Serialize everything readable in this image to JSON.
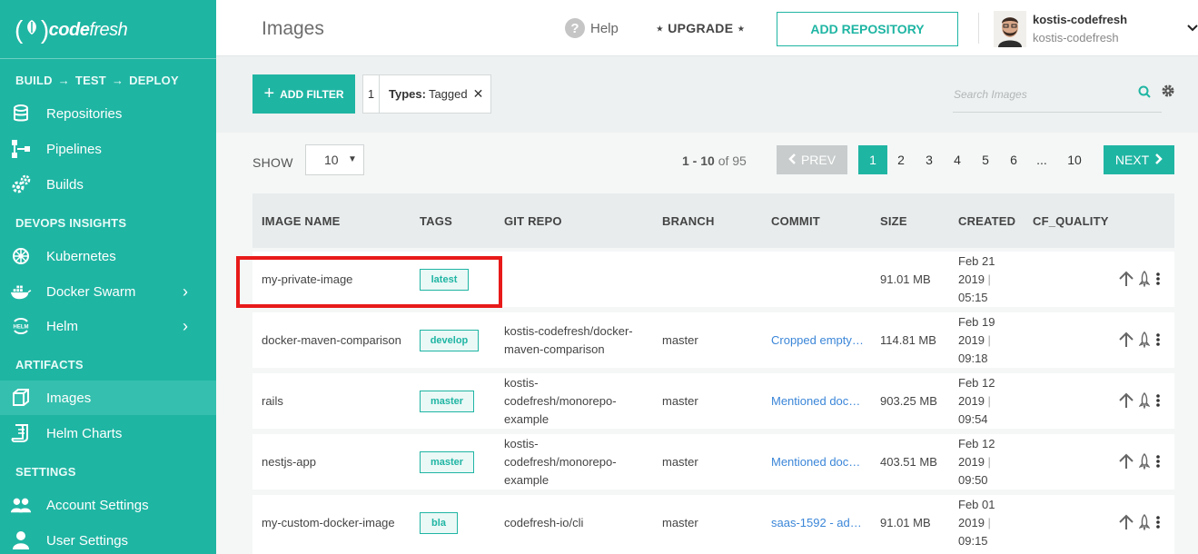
{
  "logo": {
    "word1": "code",
    "word2": "fresh"
  },
  "sidebar": {
    "pipeline_flow": {
      "build": "BUILD",
      "test": "TEST",
      "deploy": "DEPLOY"
    },
    "items_build": [
      {
        "label": "Repositories"
      },
      {
        "label": "Pipelines"
      },
      {
        "label": "Builds"
      }
    ],
    "section_devops": "DEVOPS INSIGHTS",
    "items_devops": [
      {
        "label": "Kubernetes"
      },
      {
        "label": "Docker Swarm"
      },
      {
        "label": "Helm"
      }
    ],
    "section_artifacts": "ARTIFACTS",
    "items_artifacts": [
      {
        "label": "Images"
      },
      {
        "label": "Helm Charts"
      }
    ],
    "section_settings": "SETTINGS",
    "items_settings": [
      {
        "label": "Account Settings"
      },
      {
        "label": "User Settings"
      }
    ]
  },
  "header": {
    "title": "Images",
    "help": "Help",
    "upgrade": "⋆ UPGRADE ⋆",
    "add_repository": "ADD REPOSITORY",
    "user_name": "kostis-codefresh",
    "user_account": "kostis-codefresh"
  },
  "filters": {
    "add_filter": "ADD FILTER",
    "chip_count": "1",
    "chip_key": "Types:",
    "chip_value": "Tagged",
    "search_placeholder": "Search Images"
  },
  "pagination": {
    "show_label": "SHOW",
    "page_size": "10",
    "range": "1 - 10",
    "of_total": "of 95",
    "prev": "PREV",
    "pages": [
      "1",
      "2",
      "3",
      "4",
      "5",
      "6",
      "...",
      "10"
    ],
    "current_page": "1",
    "next": "NEXT"
  },
  "table": {
    "columns": [
      "IMAGE NAME",
      "TAGS",
      "GIT REPO",
      "BRANCH",
      "COMMIT",
      "SIZE",
      "CREATED",
      "CF_QUALITY"
    ],
    "rows": [
      {
        "name": "my-private-image",
        "tag": "latest",
        "repo1": "",
        "repo2": "",
        "repo3": "",
        "branch": "",
        "commit": "",
        "size": "91.01 MB",
        "date1": "Feb 21",
        "date2": "2019",
        "time": "05:15"
      },
      {
        "name": "docker-maven-comparison",
        "tag": "develop",
        "repo1": "kostis-codefresh/docker-",
        "repo2": "maven-comparison",
        "repo3": "",
        "branch": "master",
        "commit": "Cropped empty…",
        "size": "114.81 MB",
        "date1": "Feb 19",
        "date2": "2019",
        "time": "09:18"
      },
      {
        "name": "rails",
        "tag": "master",
        "repo1": "kostis-",
        "repo2": "codefresh/monorepo-",
        "repo3": "example",
        "branch": "master",
        "commit": "Mentioned doc…",
        "size": "903.25 MB",
        "date1": "Feb 12",
        "date2": "2019",
        "time": "09:54"
      },
      {
        "name": "nestjs-app",
        "tag": "master",
        "repo1": "kostis-",
        "repo2": "codefresh/monorepo-",
        "repo3": "example",
        "branch": "master",
        "commit": "Mentioned doc…",
        "size": "403.51 MB",
        "date1": "Feb 12",
        "date2": "2019",
        "time": "09:50"
      },
      {
        "name": "my-custom-docker-image",
        "tag": "bla",
        "repo1": "codefresh-io/cli",
        "repo2": "",
        "repo3": "",
        "branch": "master",
        "commit": "saas-1592 - ad…",
        "size": "91.01 MB",
        "date1": "Feb 01",
        "date2": "2019",
        "time": "09:15"
      }
    ]
  },
  "colors": {
    "brand": "#1fb5a3",
    "link": "#3b86d8",
    "highlight": "#e81a1a"
  }
}
